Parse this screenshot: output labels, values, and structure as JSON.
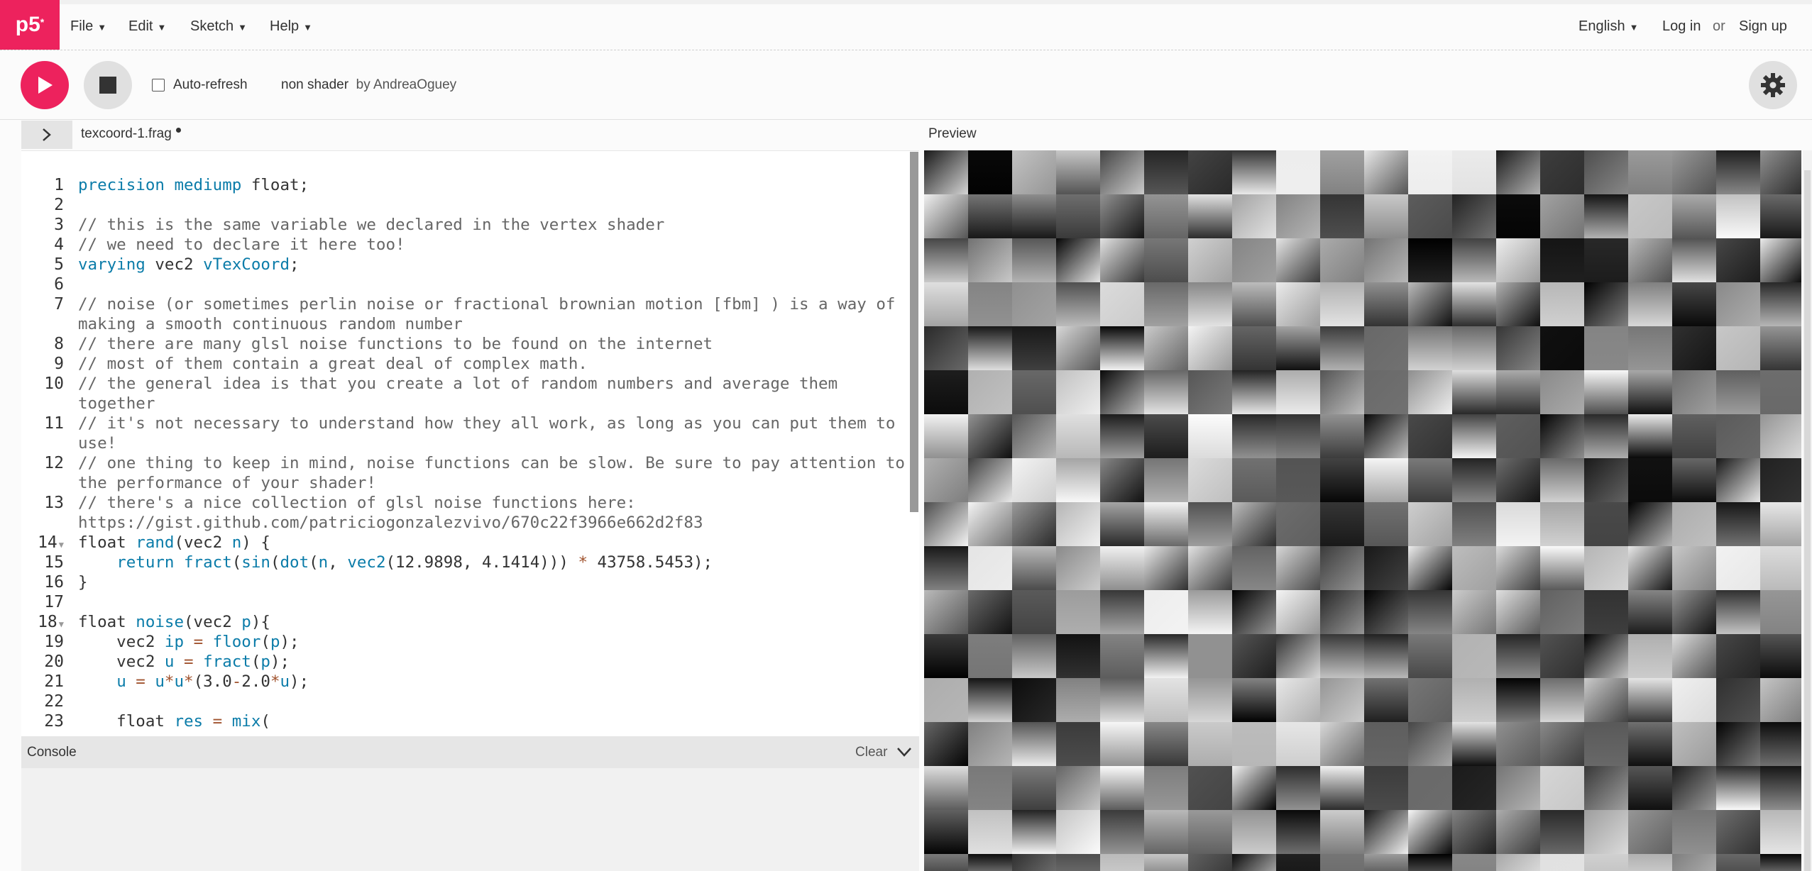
{
  "app": {
    "logo_text": "p5",
    "logo_star": "*",
    "brand_color": "#ed225d"
  },
  "menu": {
    "file": "File",
    "edit": "Edit",
    "sketch": "Sketch",
    "help": "Help",
    "language": "English",
    "login": "Log in",
    "or": "or",
    "signup": "Sign up"
  },
  "toolbar": {
    "autorefresh_label": "Auto-refresh",
    "autorefresh_checked": false,
    "sketch_name": "non shader",
    "by_author": "by AndreaOguey",
    "play_icon": "play-icon",
    "stop_icon": "stop-icon",
    "settings_icon": "gear-icon"
  },
  "editor": {
    "file_name": "texcoord-1.frag",
    "unsaved": true,
    "line_numbers": [
      "1",
      "2",
      "3",
      "4",
      "5",
      "6",
      "7",
      "",
      "8",
      "9",
      "10",
      "",
      "11",
      "",
      "12",
      "",
      "13",
      "",
      "14",
      "15",
      "16",
      "17",
      "18",
      "19",
      "20",
      "21",
      "22",
      "23"
    ],
    "fold_lines": [
      "14",
      "18"
    ]
  },
  "console": {
    "title": "Console",
    "clear_label": "Clear"
  },
  "preview": {
    "label": "Preview",
    "description_colors": [
      "#000000",
      "#ffffff"
    ]
  }
}
